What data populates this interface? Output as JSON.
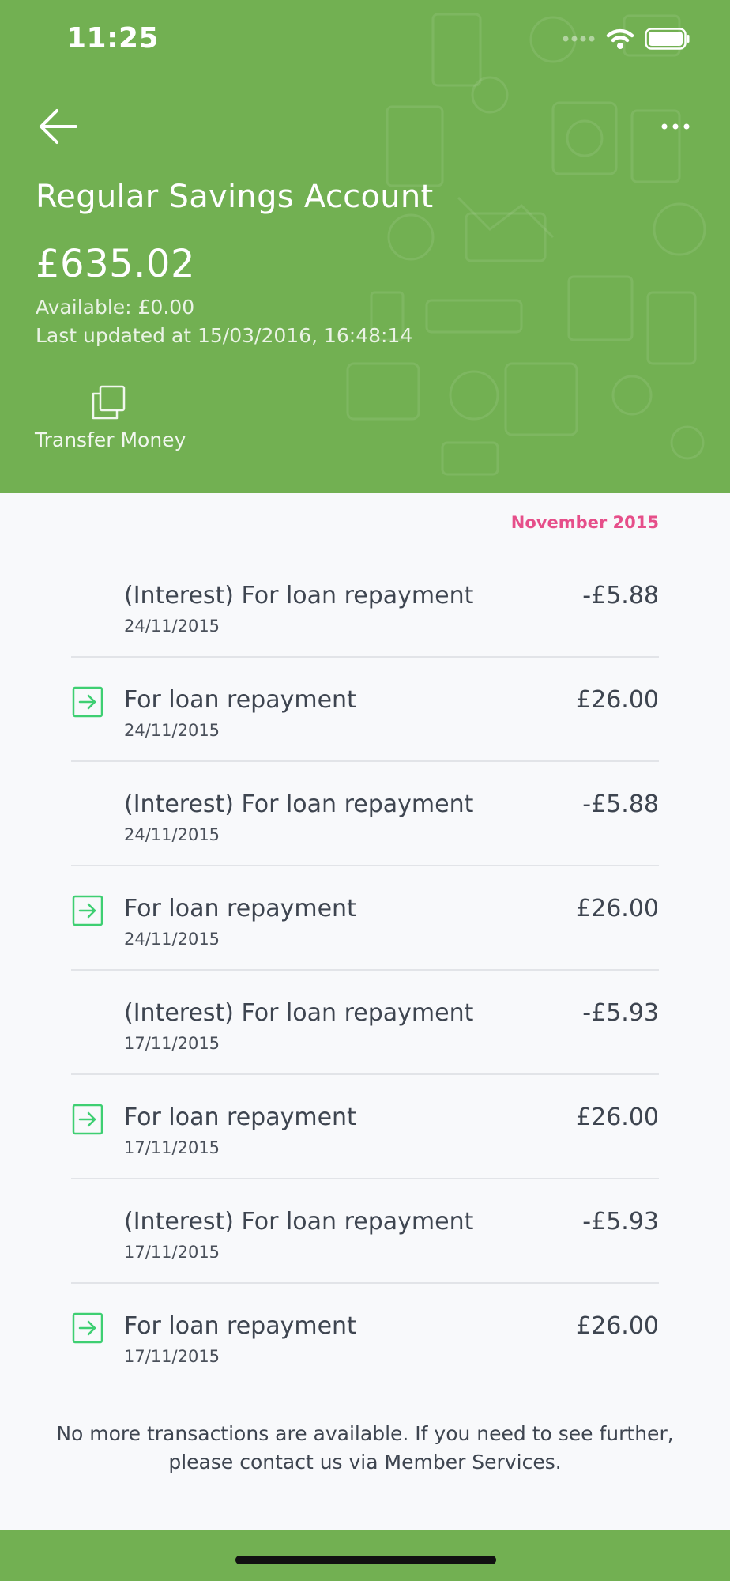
{
  "status_bar": {
    "time": "11:25",
    "signal_icon": "signal-dots-icon",
    "wifi_icon": "wifi-icon",
    "battery_icon": "battery-icon"
  },
  "header": {
    "back_icon": "arrow-left-icon",
    "more_icon": "more-horizontal-icon",
    "account_name": "Regular Savings Account",
    "balance": "£635.02",
    "available": "Available: £0.00",
    "last_updated": "Last updated at 15/03/2016, 16:48:14",
    "transfer": {
      "icon": "copy-icon",
      "label": "Transfer Money"
    },
    "colors": {
      "brand_green": "#72b052"
    }
  },
  "transactions": {
    "month": "November 2015",
    "month_color": "#e64f8a",
    "items": [
      {
        "title": "(Interest) For loan repayment",
        "date": "24/11/2015",
        "amount": "-£5.88",
        "icon": ""
      },
      {
        "title": "For loan repayment",
        "date": "24/11/2015",
        "amount": "£26.00",
        "icon": "arrow-in-icon"
      },
      {
        "title": "(Interest) For loan repayment",
        "date": "24/11/2015",
        "amount": "-£5.88",
        "icon": ""
      },
      {
        "title": "For loan repayment",
        "date": "24/11/2015",
        "amount": "£26.00",
        "icon": "arrow-in-icon"
      },
      {
        "title": "(Interest) For loan repayment",
        "date": "17/11/2015",
        "amount": "-£5.93",
        "icon": ""
      },
      {
        "title": "For loan repayment",
        "date": "17/11/2015",
        "amount": "£26.00",
        "icon": "arrow-in-icon"
      },
      {
        "title": "(Interest) For loan repayment",
        "date": "17/11/2015",
        "amount": "-£5.93",
        "icon": ""
      },
      {
        "title": "For loan repayment",
        "date": "17/11/2015",
        "amount": "£26.00",
        "icon": "arrow-in-icon"
      }
    ]
  },
  "footer": {
    "note": "No more transactions are available. If you need to see further, please contact us via Member Services."
  }
}
